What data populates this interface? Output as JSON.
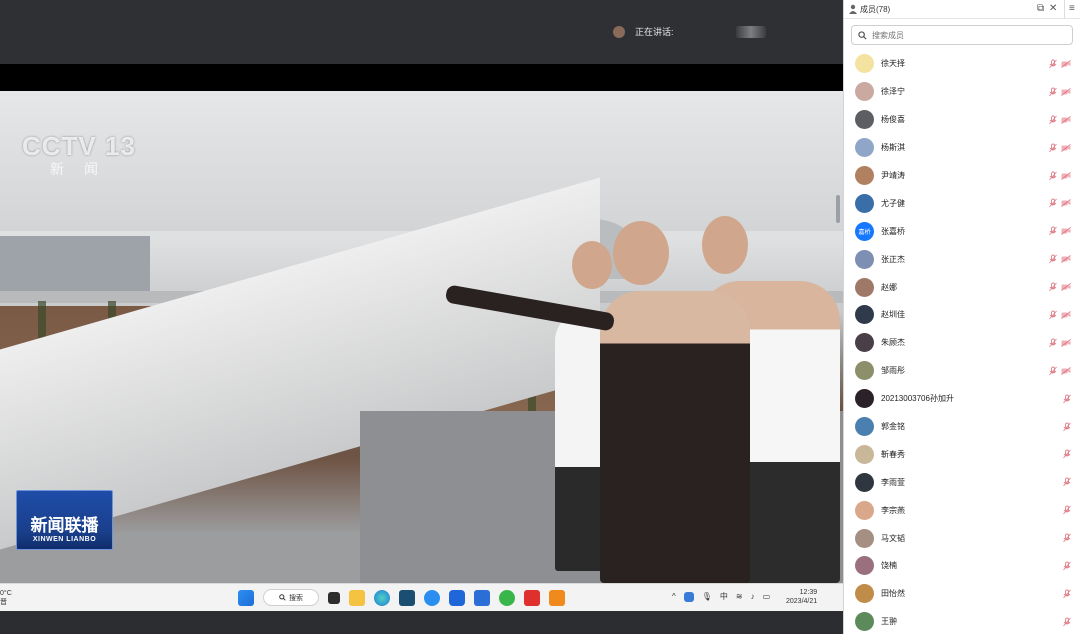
{
  "speaker_bar": {
    "label": "正在讲话:"
  },
  "video": {
    "channel_logo": "CCTV 13",
    "channel_sub": "新闻",
    "program_zh": "新闻联播",
    "program_en": "XINWEN LIANBO"
  },
  "taskbar": {
    "weather_temp": "0°C",
    "weather_desc": "晋",
    "search_label": "搜索",
    "ime": "中",
    "time": "12:39",
    "date": "2023/4/21"
  },
  "panel": {
    "title": "成员(78)",
    "search_placeholder": "搜索成员",
    "members": [
      {
        "name": "徐天择",
        "color": "#f4e2a1",
        "cam": true
      },
      {
        "name": "徐泽宁",
        "color": "#c9a9a0",
        "cam": true
      },
      {
        "name": "杨俊喜",
        "color": "#5d5e63",
        "cam": true
      },
      {
        "name": "杨斯淇",
        "color": "#8fa6c9",
        "cam": true
      },
      {
        "name": "尹靖涛",
        "color": "#b08060",
        "cam": true
      },
      {
        "name": "尤子健",
        "color": "#3a6ea8",
        "cam": true
      },
      {
        "name": "张嘉桥",
        "color": "#1677ff",
        "cam": true,
        "initials": "嘉桥"
      },
      {
        "name": "张正杰",
        "color": "#7d8fb3",
        "cam": true
      },
      {
        "name": "赵娜",
        "color": "#a07868",
        "cam": true
      },
      {
        "name": "赵圳佳",
        "color": "#2f3a4a",
        "cam": true
      },
      {
        "name": "朱顾杰",
        "color": "#4a3e48",
        "cam": true
      },
      {
        "name": "邹雨彤",
        "color": "#8c8f6a",
        "cam": true
      },
      {
        "name": "20213003706孙加升",
        "color": "#2a2228",
        "cam": false
      },
      {
        "name": "郭金铭",
        "color": "#4a7fb0",
        "cam": false
      },
      {
        "name": "靳春秀",
        "color": "#c9b79a",
        "cam": false
      },
      {
        "name": "李雨萱",
        "color": "#303640",
        "cam": false
      },
      {
        "name": "李宗燕",
        "color": "#d9a88a",
        "cam": false
      },
      {
        "name": "马文韬",
        "color": "#a58f82",
        "cam": false
      },
      {
        "name": "饶楠",
        "color": "#9a6f7e",
        "cam": false
      },
      {
        "name": "田怡然",
        "color": "#c08c4a",
        "cam": false
      },
      {
        "name": "王翀",
        "color": "#5d8a5a",
        "cam": false
      }
    ]
  }
}
